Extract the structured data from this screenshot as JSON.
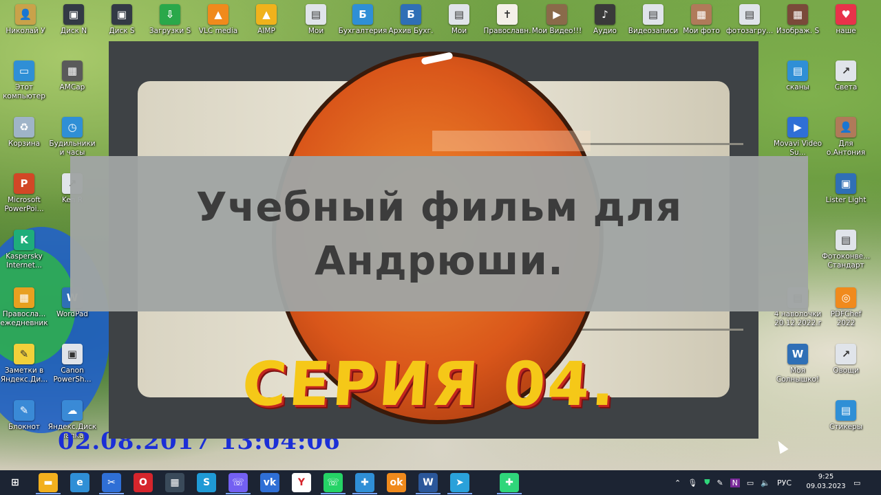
{
  "desktop": {
    "top_row": [
      {
        "label": "Николай У",
        "icon": "user-folder-icon",
        "color": "#c9a24a",
        "glyph": "👤"
      },
      {
        "label": "Диск N",
        "icon": "drive-icon",
        "color": "#333a45",
        "glyph": "▣"
      },
      {
        "label": "Диск S",
        "icon": "drive-icon",
        "color": "#333a45",
        "glyph": "▣"
      },
      {
        "label": "Загрузки S",
        "icon": "download-icon",
        "color": "#2aa84a",
        "glyph": "⇩"
      },
      {
        "label": "VLC media",
        "icon": "vlc-cone-icon",
        "color": "#f08a1c",
        "glyph": "▲"
      },
      {
        "label": "AIMP",
        "icon": "aimp-icon",
        "color": "#f0b21c",
        "glyph": "▲"
      },
      {
        "label": "Мои",
        "icon": "folder-icon",
        "color": "#e0e4ea",
        "glyph": "▤"
      },
      {
        "label": "Бухгалтерия",
        "icon": "accounting-icon",
        "color": "#2f8fd6",
        "glyph": "Б"
      },
      {
        "label": "Архив Бухг.",
        "icon": "accounting-archive-icon",
        "color": "#2f6fb6",
        "glyph": "Б"
      },
      {
        "label": "Мои",
        "icon": "folder-icon",
        "color": "#e0e4ea",
        "glyph": "▤"
      },
      {
        "label": "Православн.",
        "icon": "orthodox-icon",
        "color": "#f4f0e8",
        "glyph": "✝"
      },
      {
        "label": "Мои Видео!!!",
        "icon": "video-folder-icon",
        "color": "#8a6a4a",
        "glyph": "▶"
      },
      {
        "label": "Аудио",
        "icon": "audio-icon",
        "color": "#3a3a3a",
        "glyph": "♪"
      },
      {
        "label": "Видеозаписи",
        "icon": "video-icon",
        "color": "#e0e4ea",
        "glyph": "▤"
      },
      {
        "label": "Мои фото",
        "icon": "photo-icon",
        "color": "#b07a5a",
        "glyph": "▦"
      },
      {
        "label": "фотозагру...",
        "icon": "photo-upload-icon",
        "color": "#e0e4ea",
        "glyph": "▤"
      },
      {
        "label": "Изображ. S",
        "icon": "image-icon",
        "color": "#7a4a3a",
        "glyph": "▦"
      },
      {
        "label": "наше",
        "icon": "heart-icon",
        "color": "#e8324a",
        "glyph": "♥"
      }
    ],
    "left_col": [
      {
        "label": "Этот компьютер",
        "icon": "computer-icon",
        "color": "#2f8fd6",
        "glyph": "▭"
      },
      {
        "label": "Корзина",
        "icon": "recycle-bin-icon",
        "color": "#9fb4c8",
        "glyph": "♻"
      },
      {
        "label": "Microsoft PowerPoi...",
        "icon": "powerpoint-icon",
        "color": "#d24726",
        "glyph": "P"
      },
      {
        "label": "Kaspersky Internet...",
        "icon": "kaspersky-icon",
        "color": "#1fae7a",
        "glyph": "K"
      },
      {
        "label": "Правосла... ежедневник",
        "icon": "calendar-icon",
        "color": "#e8a020",
        "glyph": "▦"
      },
      {
        "label": "Заметки в Яндекс.Ди...",
        "icon": "notes-icon",
        "color": "#f2d03a",
        "glyph": "✎"
      },
      {
        "label": "Блокнот",
        "icon": "notepad-icon",
        "color": "#3a8ad6",
        "glyph": "✎"
      }
    ],
    "second_col": [
      {
        "label": "AMCap",
        "icon": "amcap-icon",
        "color": "#5a5a5a",
        "glyph": "▦"
      },
      {
        "label": "Будильники и часы",
        "icon": "alarm-icon",
        "color": "#2f8fd6",
        "glyph": "◷"
      },
      {
        "label": "Ken R",
        "icon": "shortcut-icon",
        "color": "#e0e4ea",
        "glyph": "↗"
      },
      {
        "label": "WordPad",
        "icon": "wordpad-icon",
        "color": "#2f6fb6",
        "glyph": "W"
      },
      {
        "label": "Canon PowerSh...",
        "icon": "canon-icon",
        "color": "#e0e4ea",
        "glyph": "▣"
      },
      {
        "label": "Яндекс.Диск папка",
        "icon": "yandex-disk-icon",
        "color": "#3a8ad6",
        "glyph": "☁"
      }
    ],
    "right_col": [
      {
        "label": "Света",
        "icon": "shortcut-icon",
        "color": "#e0e4ea",
        "glyph": "↗"
      },
      {
        "label": "Для о.Антония",
        "icon": "user-icon",
        "color": "#b07a5a",
        "glyph": "👤"
      },
      {
        "label": "Lister Light",
        "icon": "lister-icon",
        "color": "#2f6fb6",
        "glyph": "▣"
      },
      {
        "label": "Фотоконве... Стандарт",
        "icon": "photo-converter-icon",
        "color": "#e0e4ea",
        "glyph": "▤"
      },
      {
        "label": "PDFChef 2022",
        "icon": "pdfchef-icon",
        "color": "#f08a1c",
        "glyph": "◎"
      },
      {
        "label": "Овощи",
        "icon": "shortcut-icon",
        "color": "#e0e4ea",
        "glyph": "↗"
      },
      {
        "label": "Стикеры",
        "icon": "sticky-notes-icon",
        "color": "#2f8fd6",
        "glyph": "▤"
      }
    ],
    "near_right_col": [
      {
        "label": "сканы",
        "icon": "scan-folder-icon",
        "color": "#2f8fd6",
        "glyph": "▤"
      },
      {
        "label": "Movavi Video Su...",
        "icon": "movavi-icon",
        "color": "#2f6fd6",
        "glyph": "▶"
      },
      {
        "label": "4 наволочки 20.12.2022.r",
        "icon": "document-icon",
        "color": "#e0e4ea",
        "glyph": "▤"
      },
      {
        "label": "Моя Солнышко!",
        "icon": "word-doc-icon",
        "color": "#2f6fb6",
        "glyph": "W"
      }
    ],
    "timestamp_stamp": "02.08.2017 13:04:06"
  },
  "video": {
    "title": "Учебный фильм для Андрюши.",
    "series": "СЕРИЯ 04."
  },
  "taskbar": {
    "apps": [
      {
        "name": "start-button",
        "glyph": "⊞",
        "color": "#1c2433"
      },
      {
        "name": "file-explorer-icon",
        "glyph": "▬",
        "color": "#f2b01e"
      },
      {
        "name": "edge-icon",
        "glyph": "e",
        "color": "#2f8fd6"
      },
      {
        "name": "snipping-tool-icon",
        "glyph": "✂",
        "color": "#2f6fd6"
      },
      {
        "name": "opera-icon",
        "glyph": "O",
        "color": "#d6252c"
      },
      {
        "name": "calculator-icon",
        "glyph": "▦",
        "color": "#3a4a5a"
      },
      {
        "name": "skype-icon",
        "glyph": "S",
        "color": "#1f9ad6"
      },
      {
        "name": "viber-icon",
        "glyph": "☏",
        "color": "#7360f2"
      },
      {
        "name": "vk-icon",
        "glyph": "vk",
        "color": "#2f6fd6"
      },
      {
        "name": "yandex-browser-icon",
        "glyph": "Y",
        "color": "#ffffff"
      },
      {
        "name": "whatsapp-icon",
        "glyph": "☏",
        "color": "#25d366"
      },
      {
        "name": "network-app-icon",
        "glyph": "✚",
        "color": "#2f8fd6"
      },
      {
        "name": "odnoklassniki-icon",
        "glyph": "ok",
        "color": "#f08a1c"
      },
      {
        "name": "word-icon",
        "glyph": "W",
        "color": "#2b579a"
      },
      {
        "name": "telegram-icon",
        "glyph": "➤",
        "color": "#2aa1da"
      },
      {
        "name": "game-app-icon",
        "glyph": "✚",
        "color": "#2fd67a"
      }
    ],
    "tray": {
      "language": "РУС",
      "time": "9:25",
      "date": "09.03.2023"
    }
  }
}
